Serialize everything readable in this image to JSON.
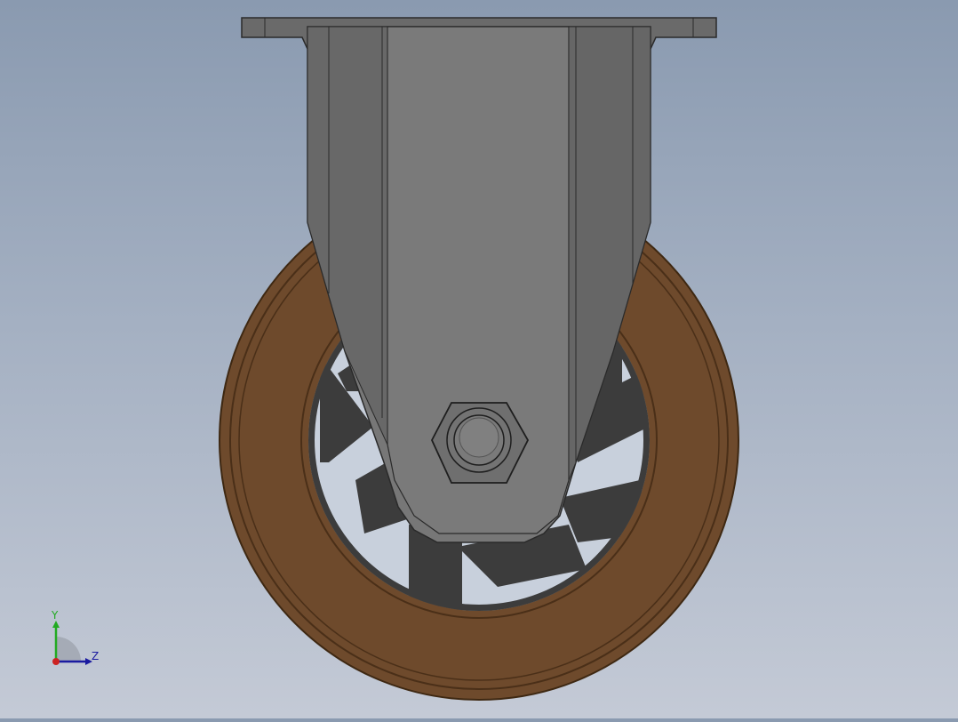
{
  "scene": {
    "model": "rigid caster",
    "colors": {
      "background_top": "#8a9ab0",
      "background_bottom": "#c4cad6",
      "tire": "#6e4a2c",
      "tire_edge": "#4a2f18",
      "bracket": "#777777",
      "bracket_dark": "#606060",
      "hub": "#3c3c3c",
      "hub_light": "#c8d0dc",
      "nut": "#6f6f6f"
    }
  },
  "triad": {
    "y_label": "Y",
    "z_label": "Z",
    "y_color": "#22aa22",
    "z_color": "#1a1aa0",
    "origin_color": "#cc2222"
  }
}
